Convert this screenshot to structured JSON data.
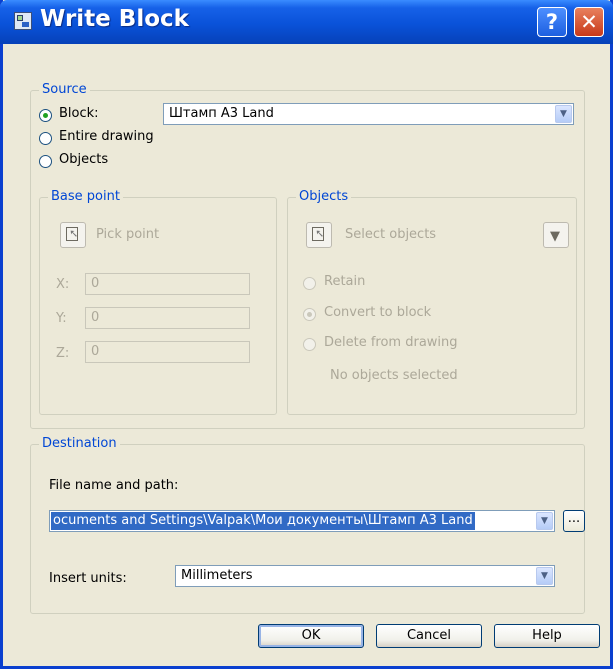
{
  "window": {
    "title": "Write Block"
  },
  "titlebar": {
    "help_label": "?",
    "close_label": "✕"
  },
  "source": {
    "legend": "Source",
    "block_radio": "Block:",
    "entire_radio": "Entire drawing",
    "objects_radio": "Objects",
    "selected": "block",
    "block_combo_value": "Штамп А3 Land"
  },
  "base_point": {
    "legend": "Base point",
    "pick_label": "Pick point",
    "x_label": "X:",
    "x_value": "0",
    "y_label": "Y:",
    "y_value": "0",
    "z_label": "Z:",
    "z_value": "0"
  },
  "objects": {
    "legend": "Objects",
    "select_label": "Select objects",
    "retain": "Retain",
    "convert": "Convert to block",
    "delete": "Delete from drawing",
    "status": "No objects selected",
    "selected": "convert"
  },
  "destination": {
    "legend": "Destination",
    "file_label": "File name and path:",
    "file_value": "ocuments and Settings\\Valpak\\Мои документы\\Штамп А3 Land",
    "browse_label": "...",
    "units_label": "Insert units:",
    "units_value": "Millimeters"
  },
  "buttons": {
    "ok": "OK",
    "cancel": "Cancel",
    "help": "Help"
  },
  "icons": {
    "app": "write-block-app-icon",
    "help": "help-icon",
    "close": "close-icon",
    "dropdown": "chevron-down-icon",
    "pick": "pick-point-icon",
    "select": "select-objects-icon",
    "quick_select": "quick-select-filter-icon"
  },
  "colors": {
    "titlebar": "#0a52d9",
    "legend": "#0046d5",
    "selection": "#316ac5",
    "disabled": "#aca899"
  }
}
